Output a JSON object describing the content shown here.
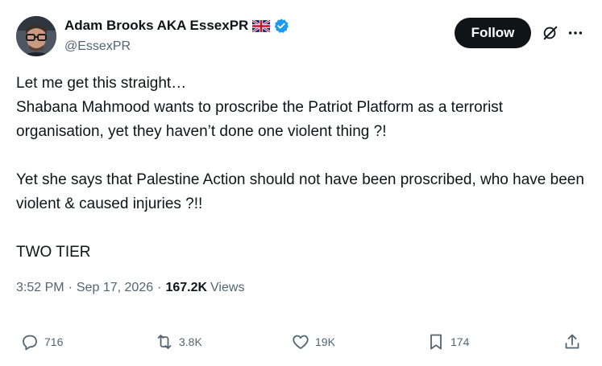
{
  "author": {
    "name": "Adam Brooks AKA EssexPR",
    "handle": "@EssexPR"
  },
  "follow_label": "Follow",
  "tweet": {
    "line1": "Let me get this straight…",
    "para1": "Shabana Mahmood wants to proscribe the Patriot Platform as a terrorist organisation, yet they haven’t done one violent thing ?!",
    "para2": "Yet she says that Palestine Action should not have been proscribed, who have been violent & caused injuries ?!!",
    "para3": "TWO TIER"
  },
  "meta": {
    "time": "3:52 PM",
    "date": "Sep 17, 2026",
    "views_count": "167.2K",
    "views_label": "Views"
  },
  "actions": {
    "replies": "716",
    "reposts": "3.8K",
    "likes": "19K",
    "bookmarks": "174"
  },
  "icons": [
    "avatar",
    "uk-flag-icon",
    "verified-badge-icon",
    "grok-icon",
    "more-options-icon",
    "reply-icon",
    "repost-icon",
    "like-icon",
    "bookmark-icon",
    "share-icon"
  ],
  "colors": {
    "text": "#0f1419",
    "secondary": "#536471",
    "verified": "#1d9bf0",
    "button": "#0f1419"
  }
}
